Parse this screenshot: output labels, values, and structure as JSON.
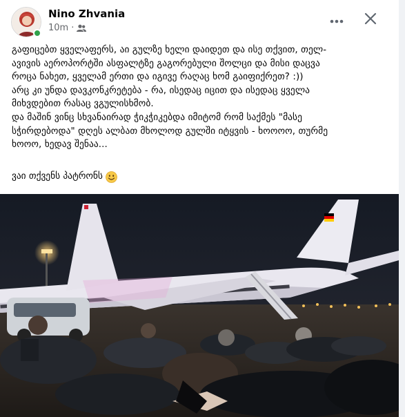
{
  "author": {
    "name": "Nino Zhvania",
    "online": true
  },
  "meta": {
    "timestamp": "10m",
    "separator": "·",
    "audience_icon": "friends-icon"
  },
  "actions": {
    "more_icon": "more-horizontal-icon",
    "close_icon": "close-icon"
  },
  "post": {
    "lines": [
      "გაფიცებთ ყველაფერს, აი გულზე ხელი დაიდეთ და ისე თქვით, თელ-",
      "ავივის აეროპორტში ასფალტზე გაგორებული შოლცი და მისი დაცვა",
      "როცა ნახეთ, ყველამ ერთი და იგივე რაღაც ხომ გაიფიქრეთ? :))",
      "არც კი უნდა დავკონკრეტება - რა, ისედაც იცით და ისედაც ყველა",
      "მიხვდებით რასაც ვგულისხმობ.",
      "და მაშინ ვინც სხვანაირად ჭიკჭიკებდა იმიტომ რომ საქმეს \"მასე",
      "სჭირდებოდა\" დღეს ალბათ მხოლოდ გულში იტყვის - ხოოოო, თურმე",
      "ხოოო, ხედავ შენაა..."
    ],
    "closing": "ვაი თქვენს პატრონს",
    "closing_emoji": "smiling-face-emoji"
  },
  "photo": {
    "subject": "people lying on airport tarmac at night beside a large airplane",
    "plane_tail_label": "Deutschland flag on tail",
    "colors": {
      "sky": "#1a1f2b",
      "plane": "#e8e6ef",
      "tarmac": "#2a2622",
      "lights": "#f4c15a"
    }
  }
}
